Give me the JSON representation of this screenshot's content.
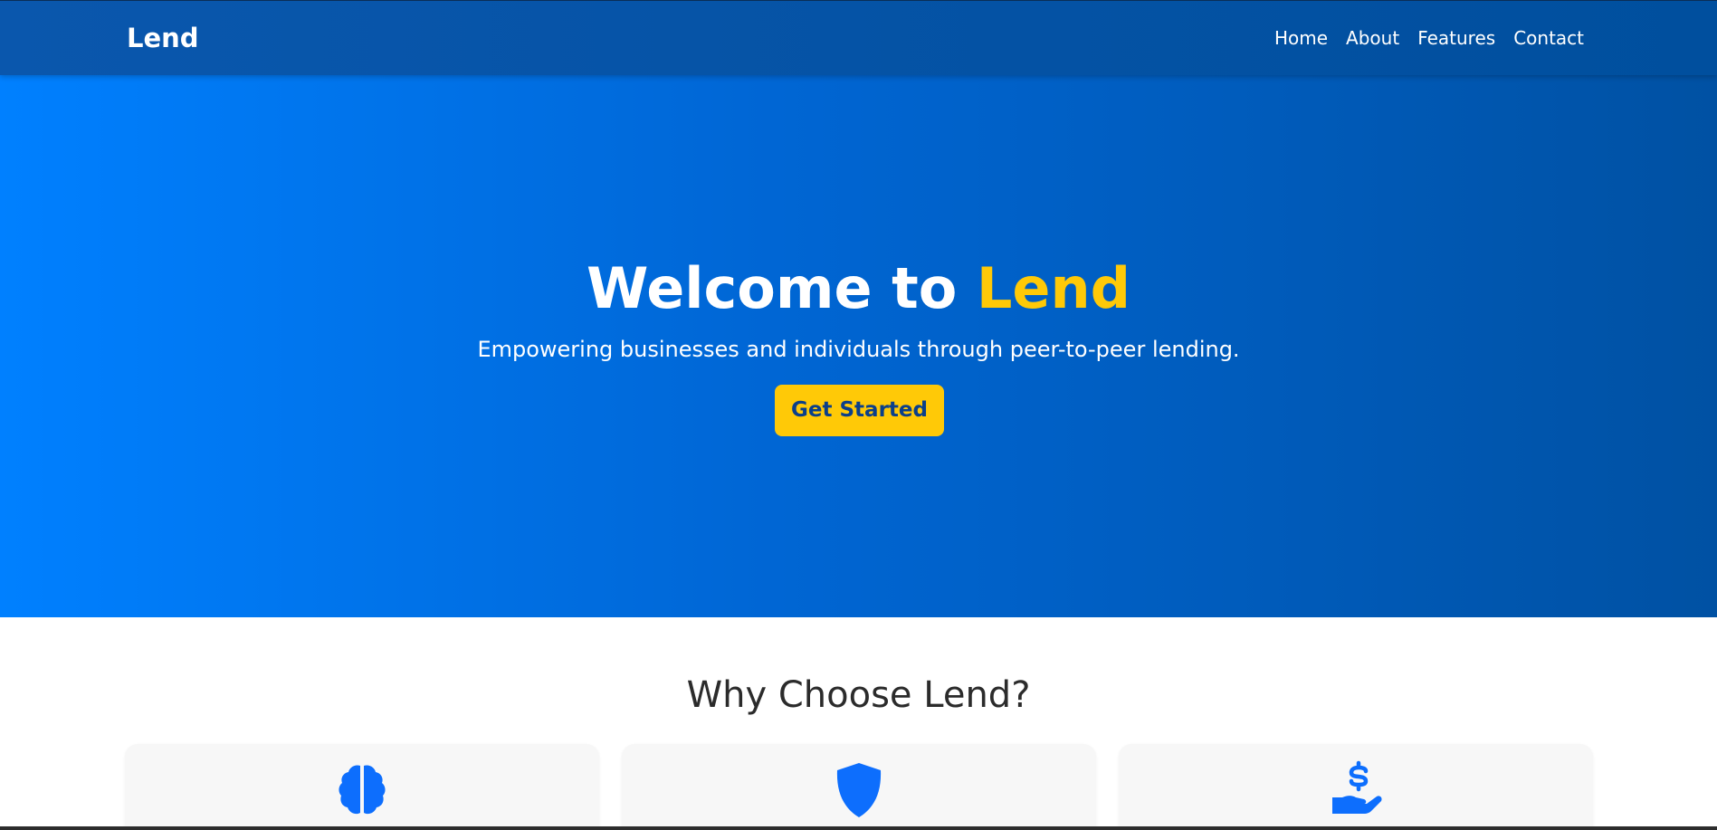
{
  "navbar": {
    "brand": "Lend",
    "links": [
      {
        "label": "Home"
      },
      {
        "label": "About"
      },
      {
        "label": "Features"
      },
      {
        "label": "Contact"
      }
    ]
  },
  "hero": {
    "title_prefix": "Welcome to ",
    "title_accent": "Lend",
    "subtitle": "Empowering businesses and individuals through peer-to-peer lending.",
    "cta_label": "Get Started"
  },
  "features": {
    "title": "Why Choose Lend?",
    "cards": [
      {
        "icon": "brain-icon"
      },
      {
        "icon": "shield-icon"
      },
      {
        "icon": "hand-holding-dollar-icon"
      }
    ]
  },
  "colors": {
    "primary": "#0073e6",
    "nav": "#004f9e",
    "accent": "#ffc907",
    "icon": "#0d6efd"
  }
}
